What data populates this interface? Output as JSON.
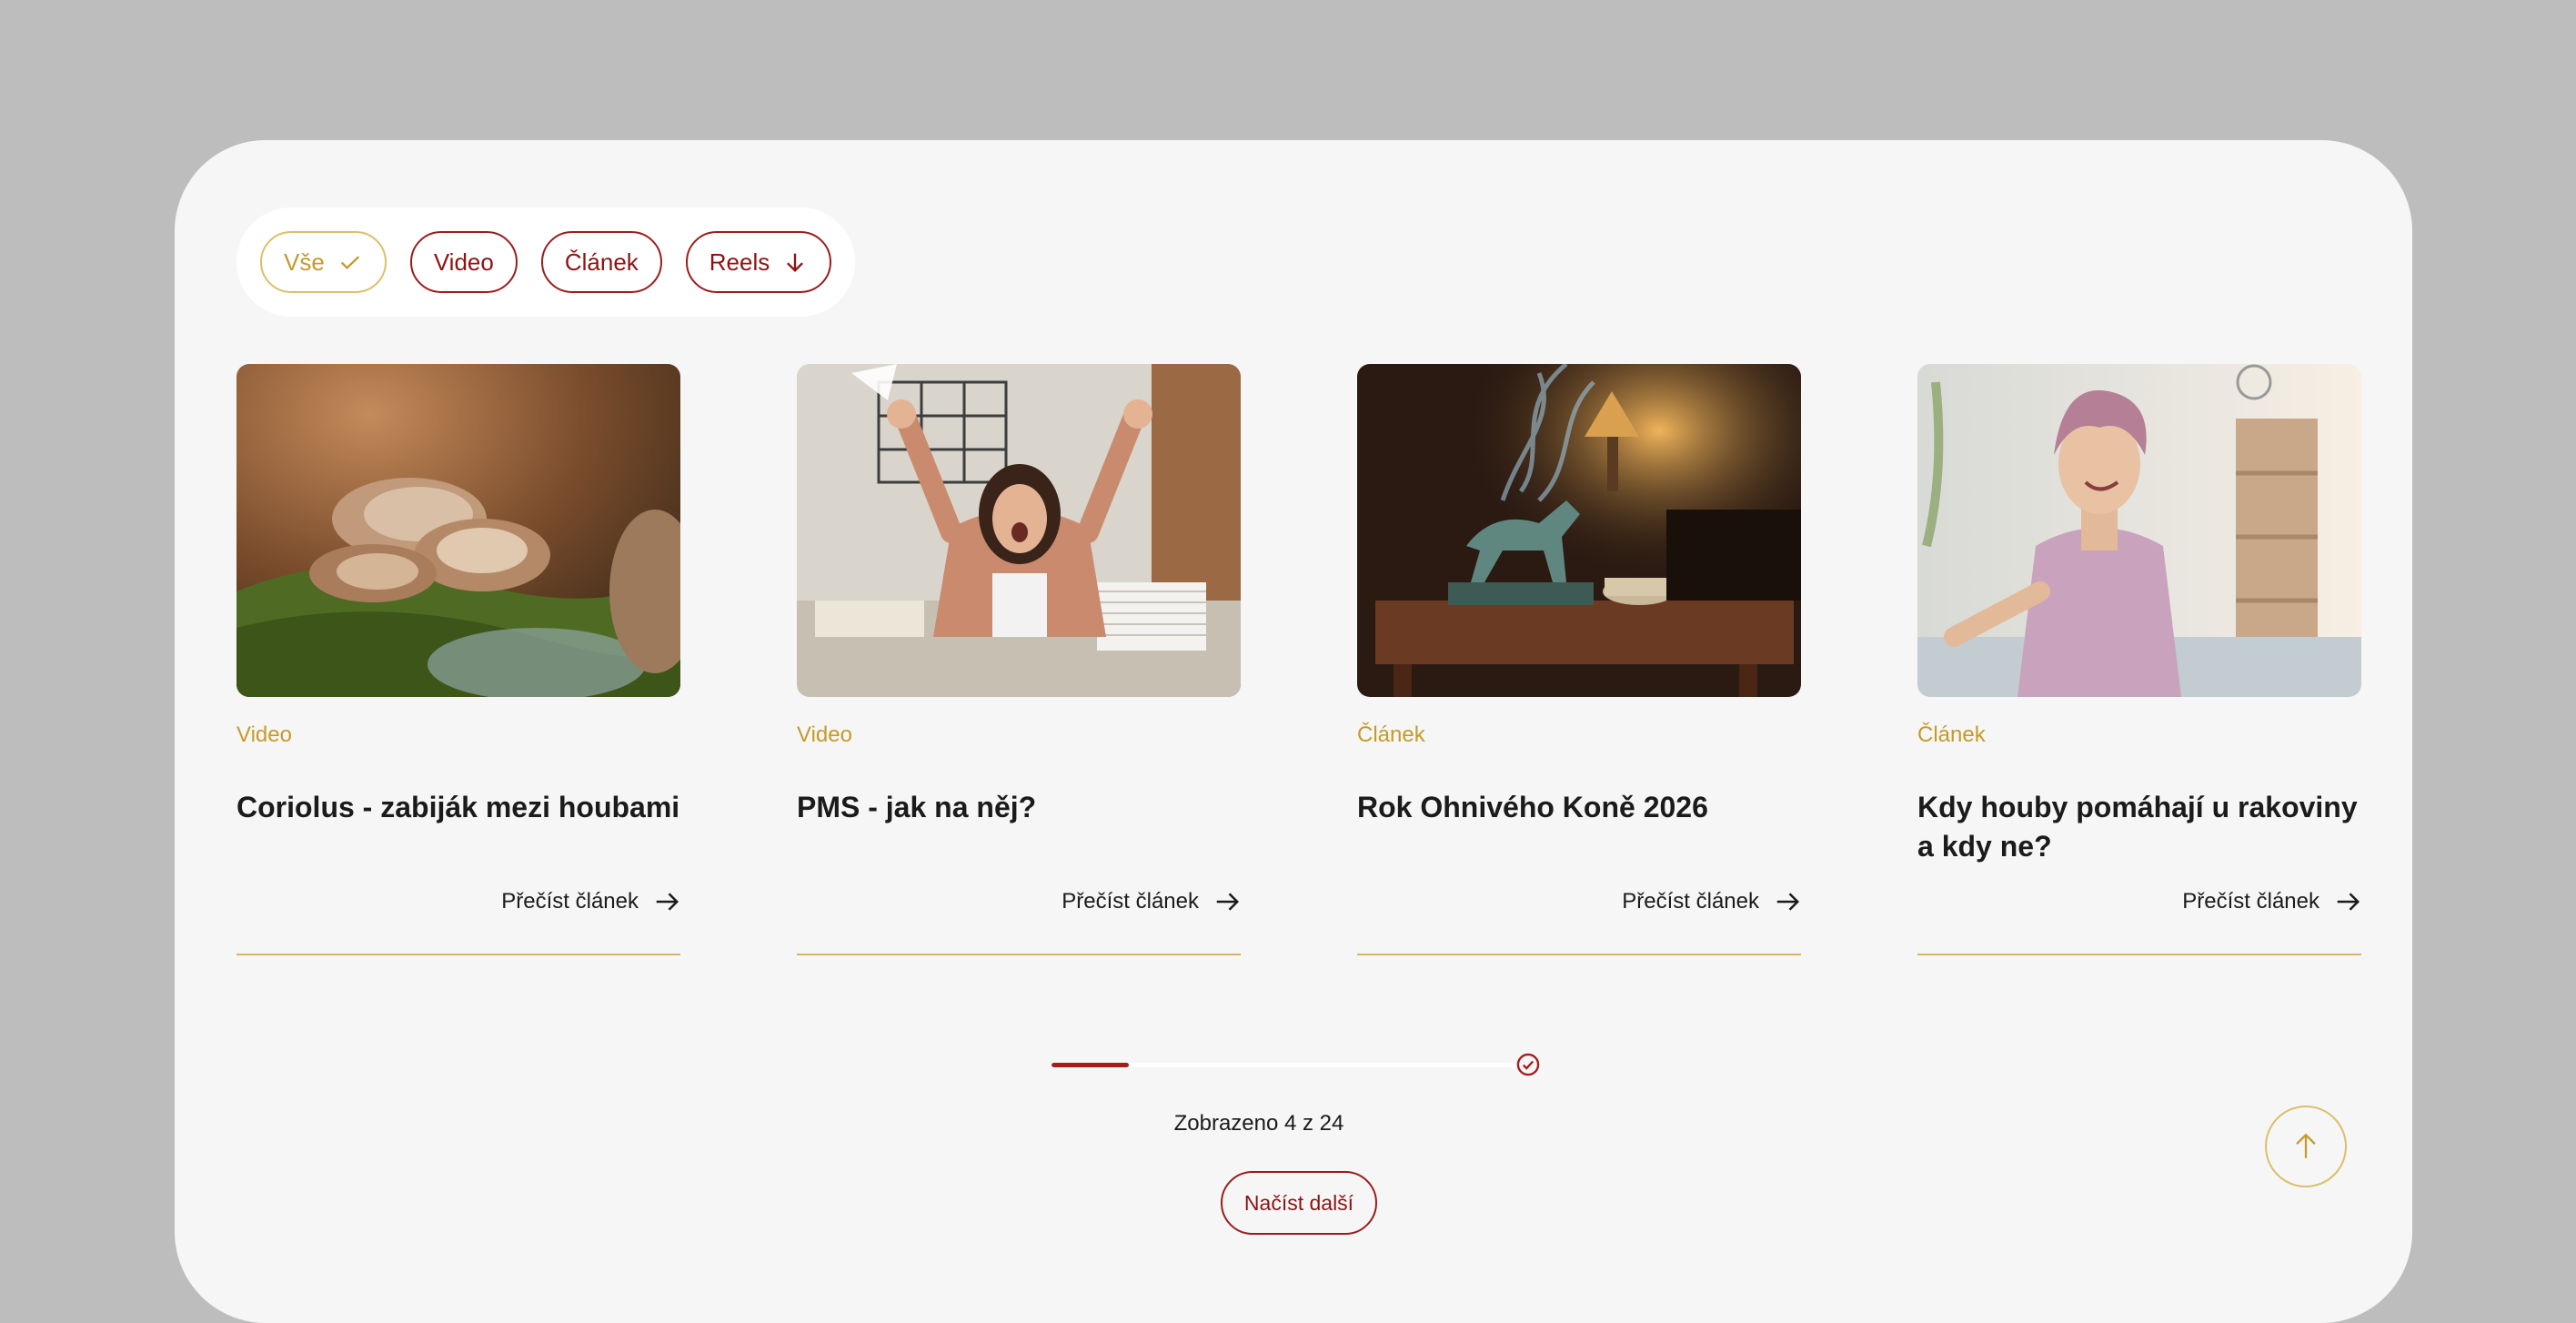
{
  "filters": [
    {
      "label": "Vše",
      "icon": "check-icon",
      "active": true
    },
    {
      "label": "Video",
      "active": false
    },
    {
      "label": "Článek",
      "active": false
    },
    {
      "label": "Reels",
      "icon": "arrow-down-icon",
      "active": false
    }
  ],
  "cards": [
    {
      "category": "Video",
      "title": "Coriolus - zabiják mezi houbami",
      "read_label": "Přečíst článek",
      "image": "turkey-tail-mushroom-photo"
    },
    {
      "category": "Video",
      "title": "PMS - jak na něj?",
      "read_label": "Přečíst článek",
      "image": "stressed-woman-office-photo"
    },
    {
      "category": "Článek",
      "title": "Rok Ohnivého Koně 2026",
      "read_label": "Přečíst článek",
      "image": "horse-statue-incense-photo"
    },
    {
      "category": "Článek",
      "title": "Kdy houby pomáhají u rakoviny a kdy ne?",
      "read_label": "Přečíst článek",
      "image": "smiling-woman-headscarf-photo"
    }
  ],
  "pagination": {
    "shown_text": "Zobrazeno 4 z 24",
    "progress_fraction": 0.1667,
    "load_more_label": "Načíst další"
  },
  "colors": {
    "accent_red": "#9b1c1c",
    "accent_gold": "#c69a29",
    "panel_bg": "#f6f6f6",
    "outer_bg": "#bdbdbd"
  }
}
